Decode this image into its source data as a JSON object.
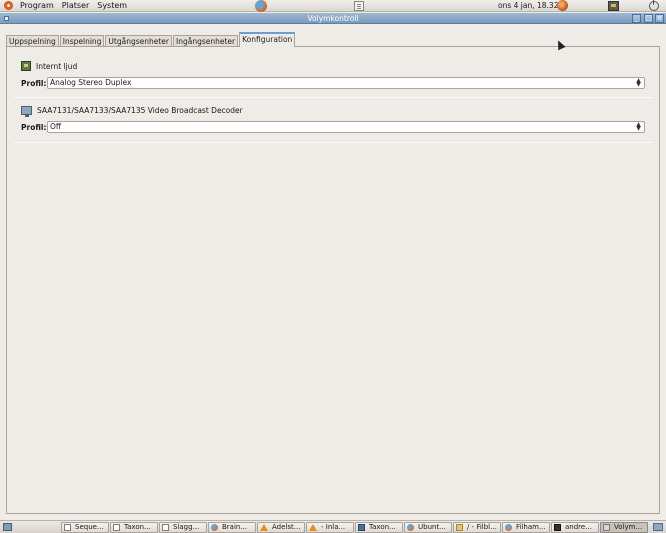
{
  "top_panel": {
    "menus": [
      "Program",
      "Platser",
      "System"
    ],
    "clock": "ons  4 jan, 18.32"
  },
  "window": {
    "title": "Volymkontroll"
  },
  "tabs": [
    {
      "label": "Uppspelning",
      "active": false
    },
    {
      "label": "Inspelning",
      "active": false
    },
    {
      "label": "Utgångsenheter",
      "active": false
    },
    {
      "label": "Ingångsenheter",
      "active": false
    },
    {
      "label": "Konfiguration",
      "active": true
    }
  ],
  "devices": [
    {
      "name": "Internt ljud",
      "icon": "sound-card-icon",
      "profile_label": "Profil:",
      "profile_value": "Analog Stereo Duplex"
    },
    {
      "name": "SAA7131/SAA7133/SAA7135 Video Broadcast Decoder",
      "icon": "tv-tuner-icon",
      "profile_label": "Profil:",
      "profile_value": "Off"
    }
  ],
  "taskbar": [
    {
      "label": "Seque...",
      "icon": "document-icon"
    },
    {
      "label": "Taxon...",
      "icon": "document-icon"
    },
    {
      "label": "Slagg...",
      "icon": "document-icon"
    },
    {
      "label": "Brain...",
      "icon": "firefox-icon"
    },
    {
      "label": "Ädelst...",
      "icon": "vlc-icon"
    },
    {
      "label": "- Inla...",
      "icon": "vlc-icon"
    },
    {
      "label": "Taxon...",
      "icon": "chart-icon"
    },
    {
      "label": "Ubunt...",
      "icon": "firefox-icon"
    },
    {
      "label": "/ - Filbl...",
      "icon": "folder-icon"
    },
    {
      "label": "Filham...",
      "icon": "firefox-icon"
    },
    {
      "label": "andre...",
      "icon": "terminal-icon"
    },
    {
      "label": "Volym...",
      "icon": "volume-icon",
      "active": true
    }
  ]
}
